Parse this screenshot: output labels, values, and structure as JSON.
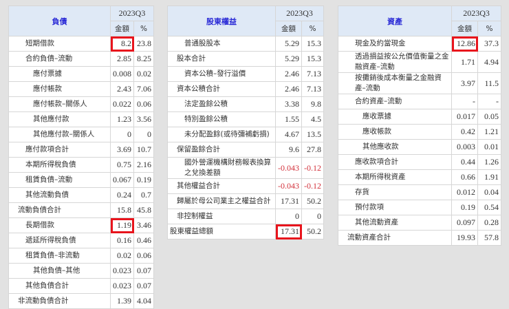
{
  "period": "2023Q3",
  "col_amount": "金額",
  "col_pct": "%",
  "highlight_color": "#e8141c",
  "liabilities": {
    "title": "負債",
    "rows": [
      {
        "label": "短期借款",
        "amount": "8.2",
        "pct": "23.8",
        "level": 1,
        "highlight": true
      },
      {
        "label": "合約負債–流動",
        "amount": "2.85",
        "pct": "8.25",
        "level": 1
      },
      {
        "label": "應付票據",
        "amount": "0.008",
        "pct": "0.02",
        "level": 2
      },
      {
        "label": "應付帳款",
        "amount": "2.43",
        "pct": "7.06",
        "level": 2
      },
      {
        "label": "應付帳款–關係人",
        "amount": "0.022",
        "pct": "0.06",
        "level": 2
      },
      {
        "label": "其他應付款",
        "amount": "1.23",
        "pct": "3.56",
        "level": 2
      },
      {
        "label": "其他應付款–關係人",
        "amount": "0",
        "pct": "0",
        "level": 2
      },
      {
        "label": "應付款項合計",
        "amount": "3.69",
        "pct": "10.7",
        "level": 1
      },
      {
        "label": "本期所得稅負債",
        "amount": "0.75",
        "pct": "2.16",
        "level": 1
      },
      {
        "label": "租賃負債–流動",
        "amount": "0.067",
        "pct": "0.19",
        "level": 1
      },
      {
        "label": "其他流動負債",
        "amount": "0.24",
        "pct": "0.7",
        "level": 1
      },
      {
        "label": "流動負債合計",
        "amount": "15.8",
        "pct": "45.8",
        "level": 0
      },
      {
        "label": "長期借款",
        "amount": "1.19",
        "pct": "3.46",
        "level": 1,
        "highlight": true
      },
      {
        "label": "遞延所得稅負債",
        "amount": "0.16",
        "pct": "0.46",
        "level": 1
      },
      {
        "label": "租賃負債–非流動",
        "amount": "0.02",
        "pct": "0.06",
        "level": 1
      },
      {
        "label": "其他負債–其他",
        "amount": "0.023",
        "pct": "0.07",
        "level": 2
      },
      {
        "label": "其他負債合計",
        "amount": "0.023",
        "pct": "0.07",
        "level": 1
      },
      {
        "label": "非流動負債合計",
        "amount": "1.39",
        "pct": "4.04",
        "level": 0
      }
    ]
  },
  "equity": {
    "title": "股東權益",
    "rows": [
      {
        "label": "普通股股本",
        "amount": "5.29",
        "pct": "15.3",
        "level": 1
      },
      {
        "label": "股本合計",
        "amount": "5.29",
        "pct": "15.3",
        "level": 0
      },
      {
        "label": "資本公積–發行溢價",
        "amount": "2.46",
        "pct": "7.13",
        "level": 1
      },
      {
        "label": "資本公積合計",
        "amount": "2.46",
        "pct": "7.13",
        "level": 0
      },
      {
        "label": "法定盈餘公積",
        "amount": "3.38",
        "pct": "9.8",
        "level": 1
      },
      {
        "label": "特別盈餘公積",
        "amount": "1.55",
        "pct": "4.5",
        "level": 1
      },
      {
        "label": "未分配盈餘(或待彌補虧損)",
        "amount": "4.67",
        "pct": "13.5",
        "level": 1
      },
      {
        "label": "保留盈餘合計",
        "amount": "9.6",
        "pct": "27.8",
        "level": 0
      },
      {
        "label": "國外營運機構財務報表換算之兌換差額",
        "amount": "-0.043",
        "pct": "-0.12",
        "level": 1,
        "negative": true
      },
      {
        "label": "其他權益合計",
        "amount": "-0.043",
        "pct": "-0.12",
        "level": 0,
        "negative": true
      },
      {
        "label": "歸屬於母公司業主之權益合計",
        "amount": "17.31",
        "pct": "50.2",
        "level": 0
      },
      {
        "label": "非控制權益",
        "amount": "0",
        "pct": "0",
        "level": 0
      },
      {
        "label": "股東權益總額",
        "amount": "17.31",
        "pct": "50.2",
        "level": -1,
        "highlight": true
      }
    ]
  },
  "assets": {
    "title": "資產",
    "rows": [
      {
        "label": "現金及約當現金",
        "amount": "12.86",
        "pct": "37.3",
        "level": 1,
        "highlight": true
      },
      {
        "label": "透過損益按公允價值衡量之金融資產–流動",
        "amount": "1.71",
        "pct": "4.94",
        "level": 1
      },
      {
        "label": "按攤銷後成本衡量之金融資產–流動",
        "amount": "3.97",
        "pct": "11.5",
        "level": 1
      },
      {
        "label": "合約資產–流動",
        "amount": "-",
        "pct": "-",
        "level": 1
      },
      {
        "label": "應收票據",
        "amount": "0.017",
        "pct": "0.05",
        "level": 2
      },
      {
        "label": "應收帳款",
        "amount": "0.42",
        "pct": "1.21",
        "level": 2
      },
      {
        "label": "其他應收款",
        "amount": "0.003",
        "pct": "0.01",
        "level": 2
      },
      {
        "label": "應收款項合計",
        "amount": "0.44",
        "pct": "1.26",
        "level": 1
      },
      {
        "label": "本期所得稅資產",
        "amount": "0.66",
        "pct": "1.91",
        "level": 1
      },
      {
        "label": "存貨",
        "amount": "0.012",
        "pct": "0.04",
        "level": 1
      },
      {
        "label": "預付款項",
        "amount": "0.19",
        "pct": "0.54",
        "level": 1
      },
      {
        "label": "其他流動資產",
        "amount": "0.097",
        "pct": "0.28",
        "level": 1
      },
      {
        "label": "流動資產合計",
        "amount": "19.93",
        "pct": "57.8",
        "level": 0
      }
    ]
  }
}
